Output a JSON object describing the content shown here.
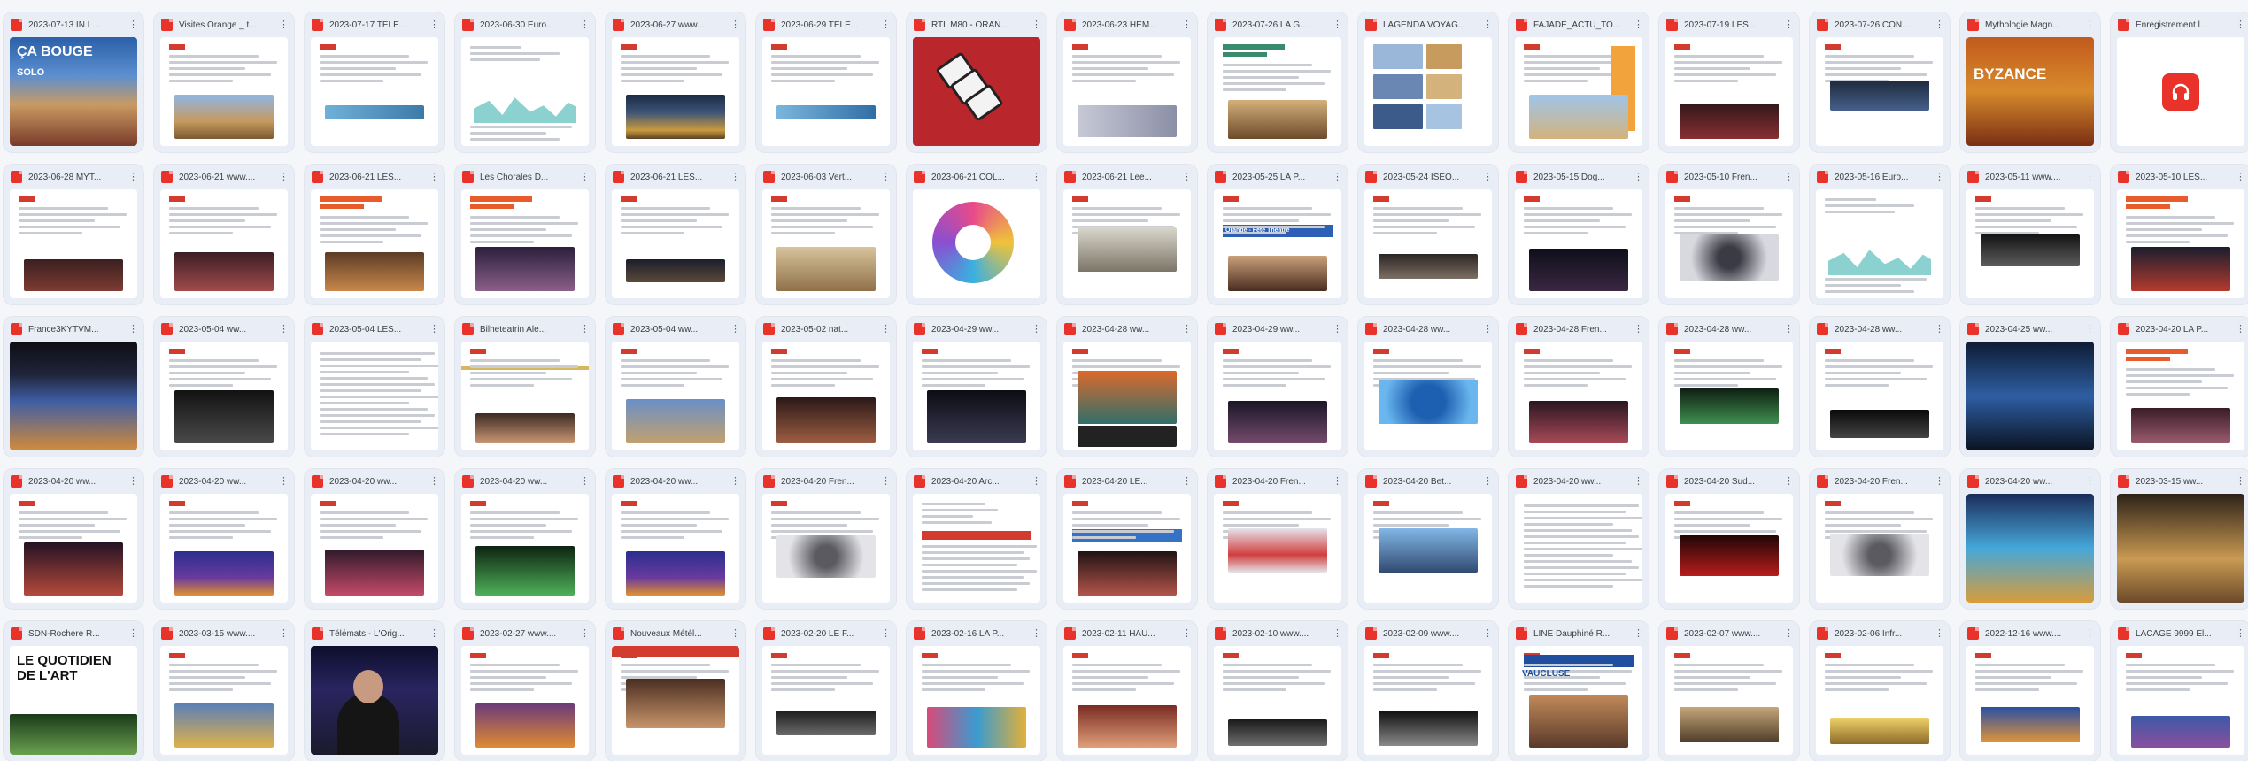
{
  "thumbnails": [
    {
      "title": "2023-07-13 IN L...",
      "overlay": "ÇA BOUGE",
      "overlay_sub": "SOLO"
    },
    {
      "title": "Visites Orange _ t..."
    },
    {
      "title": "2023-07-17 TELE..."
    },
    {
      "title": "2023-06-30 Euro..."
    },
    {
      "title": "2023-06-27 www...."
    },
    {
      "title": "2023-06-29 TELE..."
    },
    {
      "title": "RTL M80 - ORAN..."
    },
    {
      "title": "2023-06-23 HEM..."
    },
    {
      "title": "2023-07-26 LA G..."
    },
    {
      "title": "LAGENDA VOYAG..."
    },
    {
      "title": "FAJADE_ACTU_TO..."
    },
    {
      "title": "2023-07-19 LES..."
    },
    {
      "title": "2023-07-26 CON..."
    },
    {
      "title": "Mythologie Magn...",
      "overlay": "BYZANCE"
    },
    {
      "title": "Enregistrement l..."
    },
    {
      "title": "2023-06-28 MYT..."
    },
    {
      "title": "2023-06-21 www...."
    },
    {
      "title": "2023-06-21 LES..."
    },
    {
      "title": "Les Chorales D..."
    },
    {
      "title": "2023-06-21 LES..."
    },
    {
      "title": "2023-06-03 Vert..."
    },
    {
      "title": "2023-06-21 COL..."
    },
    {
      "title": "2023-06-21 Lee..."
    },
    {
      "title": "2023-05-25 LA P...",
      "overlay": "Orange - Fête Théâtre"
    },
    {
      "title": "2023-05-24 ISEO..."
    },
    {
      "title": "2023-05-15 Dog..."
    },
    {
      "title": "2023-05-10 Fren..."
    },
    {
      "title": "2023-05-16 Euro..."
    },
    {
      "title": "2023-05-11 www...."
    },
    {
      "title": "2023-05-10 LES..."
    },
    {
      "title": "France3KYTVM..."
    },
    {
      "title": "2023-05-04 ww..."
    },
    {
      "title": "2023-05-04 LES..."
    },
    {
      "title": "Bilheteatrin Ale..."
    },
    {
      "title": "2023-05-04 ww..."
    },
    {
      "title": "2023-05-02 nat..."
    },
    {
      "title": "2023-04-29 ww..."
    },
    {
      "title": "2023-04-28 ww..."
    },
    {
      "title": "2023-04-29 ww..."
    },
    {
      "title": "2023-04-28 ww..."
    },
    {
      "title": "2023-04-28 Fren..."
    },
    {
      "title": "2023-04-28 ww..."
    },
    {
      "title": "2023-04-28 ww..."
    },
    {
      "title": "2023-04-25 ww..."
    },
    {
      "title": "2023-04-20 LA P..."
    },
    {
      "title": "2023-04-20 ww..."
    },
    {
      "title": "2023-04-20 ww..."
    },
    {
      "title": "2023-04-20 ww..."
    },
    {
      "title": "2023-04-20 ww..."
    },
    {
      "title": "2023-04-20 ww..."
    },
    {
      "title": "2023-04-20 Fren..."
    },
    {
      "title": "2023-04-20 Arc..."
    },
    {
      "title": "2023-04-20 LE..."
    },
    {
      "title": "2023-04-20 Fren..."
    },
    {
      "title": "2023-04-20 Bet..."
    },
    {
      "title": "2023-04-20 ww..."
    },
    {
      "title": "2023-04-20 Sud..."
    },
    {
      "title": "2023-04-20 Fren..."
    },
    {
      "title": "2023-04-20 ww..."
    },
    {
      "title": "2023-03-15 ww..."
    },
    {
      "title": "SDN-Rochere R...",
      "overlay": "LE QUOTIDIEN DE L'ART"
    },
    {
      "title": "2023-03-15 www...."
    },
    {
      "title": "Télémats - L'Orig..."
    },
    {
      "title": "2023-02-27 www...."
    },
    {
      "title": "Nouveaux Métél..."
    },
    {
      "title": "2023-02-20 LE F..."
    },
    {
      "title": "2023-02-16 LA P..."
    },
    {
      "title": "2023-02-11 HAU..."
    },
    {
      "title": "2023-02-10 www...."
    },
    {
      "title": "2023-02-09 www...."
    },
    {
      "title": "LINE Dauphiné R...",
      "overlay": "VAUCLUSE"
    },
    {
      "title": "2023-02-07 www...."
    },
    {
      "title": "2023-02-06 Infr..."
    },
    {
      "title": "2022-12-16 www...."
    },
    {
      "title": "LACAGE 9999 El..."
    }
  ],
  "icons": {
    "file": "pdf-file-icon",
    "menu": "more-vert-icon",
    "audio": "headphones-icon"
  },
  "colors": {
    "accent": "#e8322a",
    "card": "#e9eef6"
  }
}
